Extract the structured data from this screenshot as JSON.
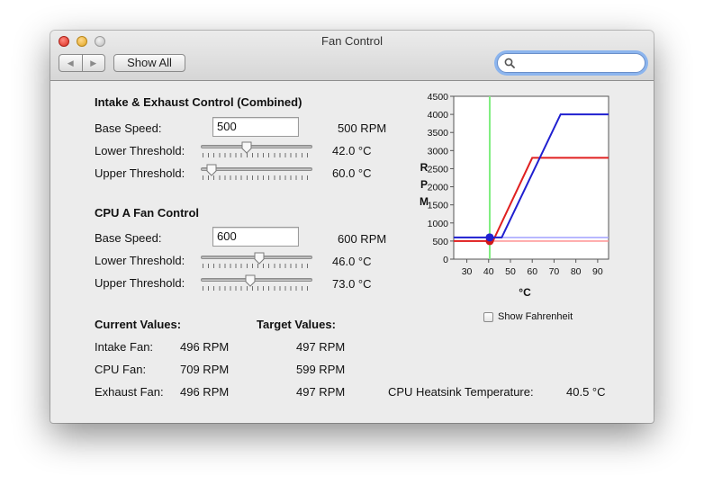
{
  "window": {
    "title": "Fan Control"
  },
  "toolbar": {
    "back_icon": "◀",
    "forward_icon": "▶",
    "show_all_label": "Show All",
    "search_placeholder": ""
  },
  "intake": {
    "heading": "Intake & Exhaust Control (Combined)",
    "base_speed_label": "Base Speed:",
    "base_speed_value": "500",
    "base_speed_readout": "500  RPM",
    "lower_label": "Lower Threshold:",
    "lower_value": "42.0 °C",
    "lower_slider_fraction": 0.4,
    "upper_label": "Upper Threshold:",
    "upper_value": "60.0 °C",
    "upper_slider_fraction": 0.05
  },
  "cpu_a": {
    "heading": "CPU A Fan Control",
    "base_speed_label": "Base Speed:",
    "base_speed_value": "600",
    "base_speed_readout": "600  RPM",
    "lower_label": "Lower Threshold:",
    "lower_value": "46.0 °C",
    "lower_slider_fraction": 0.53,
    "upper_label": "Upper Threshold:",
    "upper_value": "73.0 °C",
    "upper_slider_fraction": 0.44
  },
  "current": {
    "heading": "Current Values:",
    "rows": [
      {
        "label": "Intake Fan:",
        "value": "496  RPM"
      },
      {
        "label": "CPU Fan:",
        "value": "709  RPM"
      },
      {
        "label": "Exhaust Fan:",
        "value": "496  RPM"
      }
    ]
  },
  "target": {
    "heading": "Target Values:",
    "rows": [
      {
        "value": "497  RPM"
      },
      {
        "value": "599  RPM"
      },
      {
        "value": "497  RPM"
      }
    ]
  },
  "heatsink": {
    "label": "CPU Heatsink Temperature:",
    "value": "40.5 °C"
  },
  "fahrenheit": {
    "label": "Show Fahrenheit",
    "checked": false
  },
  "chart_data": {
    "type": "line",
    "xlabel": "°C",
    "ylabel": "R P M",
    "xlim": [
      24,
      95
    ],
    "ylim": [
      0,
      4500
    ],
    "x_ticks": [
      30,
      40,
      50,
      60,
      70,
      80,
      90
    ],
    "y_ticks": [
      0,
      500,
      1000,
      1500,
      2000,
      2500,
      3000,
      3500,
      4000,
      4500
    ],
    "current_temp_line": 40.5,
    "series": [
      {
        "color": "#e02020",
        "points": [
          [
            24,
            500
          ],
          [
            42,
            500
          ],
          [
            60,
            2800
          ],
          [
            95,
            2800
          ]
        ]
      },
      {
        "color": "#2020d0",
        "points": [
          [
            24,
            600
          ],
          [
            46,
            600
          ],
          [
            73,
            4000
          ],
          [
            95,
            4000
          ]
        ]
      },
      {
        "color": "#ff9a9a",
        "points": [
          [
            24,
            500
          ],
          [
            95,
            500
          ]
        ]
      },
      {
        "color": "#a8a8ff",
        "points": [
          [
            24,
            600
          ],
          [
            95,
            600
          ]
        ]
      }
    ],
    "markers": [
      {
        "x": 40.5,
        "y": 500,
        "color": "#d01818"
      },
      {
        "x": 40.5,
        "y": 600,
        "color": "#2020d0"
      }
    ]
  }
}
